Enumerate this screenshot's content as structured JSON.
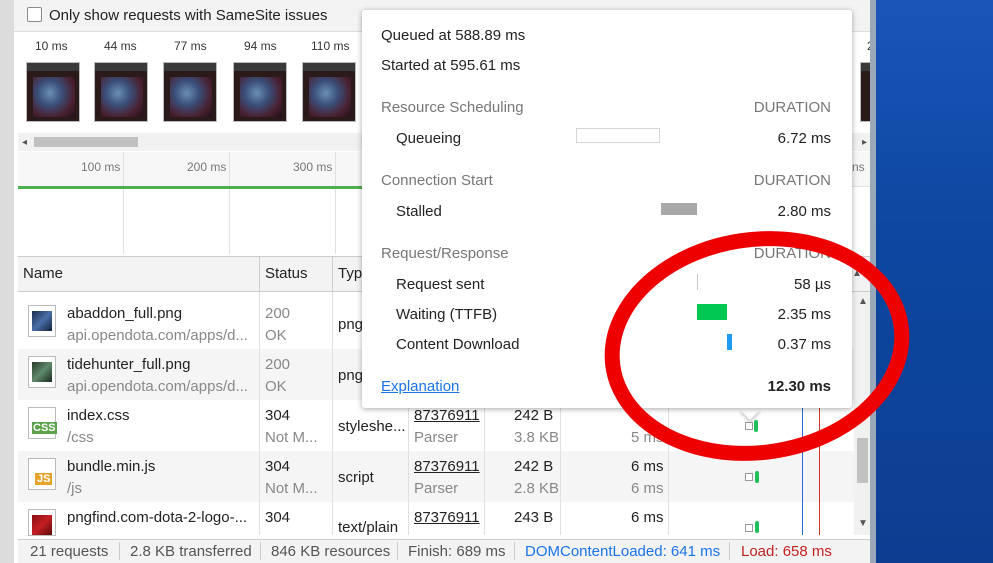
{
  "filter": {
    "samesite_label": "Only show requests with SameSite issues"
  },
  "filmstrip": {
    "times": [
      "10 ms",
      "44 ms",
      "77 ms",
      "94 ms",
      "110 ms",
      "2"
    ]
  },
  "overview": {
    "ticks": [
      "100 ms",
      "200 ms",
      "300 ms"
    ],
    "tick_right": "ns"
  },
  "table": {
    "headers": [
      "Name",
      "Status",
      "Typ"
    ],
    "rows": [
      {
        "name": "abaddon_full.png",
        "path": "api.opendota.com/apps/d...",
        "status": "200",
        "status_text": "OK",
        "type": "png",
        "initiator": "",
        "initiator_sub": "",
        "size": "",
        "size_sub": "",
        "time": "",
        "time_sub": ""
      },
      {
        "name": "tidehunter_full.png",
        "path": "api.opendota.com/apps/d...",
        "status": "200",
        "status_text": "OK",
        "type": "png",
        "initiator": "",
        "initiator_sub": "",
        "size": "",
        "size_sub": "",
        "time": "",
        "time_sub": ""
      },
      {
        "name": "index.css",
        "path": "/css",
        "status": "304",
        "status_text": "Not M...",
        "type": "styleshe...",
        "initiator": "87376911",
        "initiator_sub": "Parser",
        "size": "242 B",
        "size_sub": "3.8 KB",
        "time": "",
        "time_sub": "5 ms"
      },
      {
        "name": "bundle.min.js",
        "path": "/js",
        "status": "304",
        "status_text": "Not M...",
        "type": "script",
        "initiator": "87376911",
        "initiator_sub": "Parser",
        "size": "242 B",
        "size_sub": "2.8 KB",
        "time": "6 ms",
        "time_sub": "6 ms"
      },
      {
        "name": "pngfind.com-dota-2-logo-...",
        "path": "",
        "status": "304",
        "status_text": "",
        "type": "text/plain",
        "initiator": "87376911",
        "initiator_sub": "",
        "size": "243 B",
        "size_sub": "",
        "time": "6 ms",
        "time_sub": ""
      }
    ]
  },
  "status_bar": {
    "requests": "21 requests",
    "transferred": "2.8 KB transferred",
    "resources": "846 KB resources",
    "finish": "Finish: 689 ms",
    "dom": "DOMContentLoaded: 641 ms",
    "load": "Load: 658 ms",
    "dom_color": "#1a73e8",
    "load_color": "#c5221f"
  },
  "timing_popup": {
    "queued": "Queued at 588.89 ms",
    "started": "Started at 595.61 ms",
    "sections": [
      {
        "title": "Resource Scheduling",
        "duration_label": "DURATION",
        "items": [
          {
            "label": "Queueing",
            "value": "6.72 ms"
          }
        ]
      },
      {
        "title": "Connection Start",
        "duration_label": "DURATION",
        "items": [
          {
            "label": "Stalled",
            "value": "2.80 ms"
          }
        ]
      },
      {
        "title": "Request/Response",
        "duration_label": "DURATION",
        "items": [
          {
            "label": "Request sent",
            "value": "58 µs"
          },
          {
            "label": "Waiting (TTFB)",
            "value": "2.35 ms"
          },
          {
            "label": "Content Download",
            "value": "0.37 ms"
          }
        ]
      }
    ],
    "explanation": "Explanation",
    "total": "12.30 ms",
    "colors": {
      "queueing": "#ffffff",
      "stalled": "#a8a8a8",
      "ttfb": "#00c853",
      "download": "#1e9bf0"
    }
  },
  "annotation": {
    "color": "#ee0000"
  }
}
